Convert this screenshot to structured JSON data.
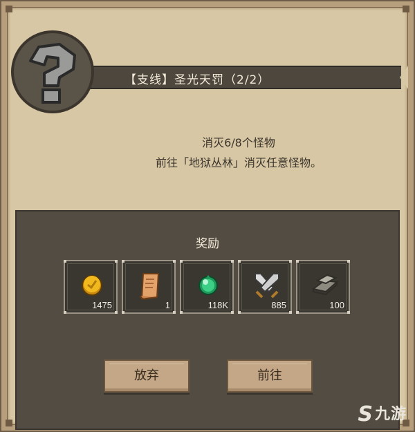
{
  "quest": {
    "title": "【支线】圣光天罚（2/2）",
    "desc_line1": "消灭6/8个怪物",
    "desc_line2": "前往「地狱丛林」消灭任意怪物。"
  },
  "rewards": {
    "title": "奖励",
    "items": [
      {
        "icon": "gold-coin-icon",
        "qty": "1475"
      },
      {
        "icon": "scroll-icon",
        "qty": "1"
      },
      {
        "icon": "green-gem-icon",
        "qty": "118K"
      },
      {
        "icon": "crossed-swords-icon",
        "qty": "885"
      },
      {
        "icon": "book-icon",
        "qty": "100"
      }
    ]
  },
  "buttons": {
    "abandon": "放弃",
    "go": "前往"
  },
  "watermark": {
    "logo": "S",
    "text": "九游"
  },
  "colors": {
    "parchment": "#d8c7a5",
    "dark_panel": "#524c42",
    "button": "#c3a787"
  }
}
